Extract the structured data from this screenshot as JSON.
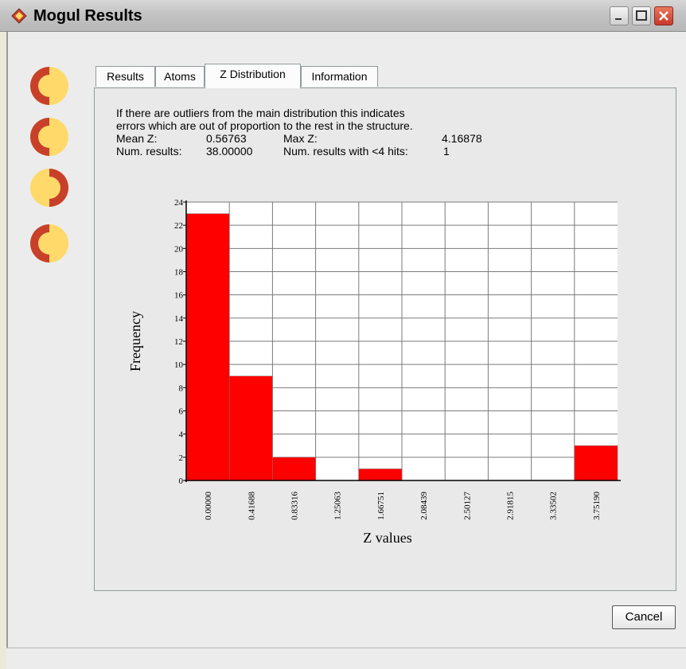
{
  "window": {
    "title": "Mogul Results"
  },
  "sidebar": {
    "icons": [
      "crescent-left-icon",
      "crescent-left-icon",
      "crescent-right-icon",
      "crescent-left-icon"
    ]
  },
  "tabs": [
    {
      "label": "Results",
      "active": false
    },
    {
      "label": "Atoms",
      "active": false
    },
    {
      "label": "Z Distribution",
      "active": true
    },
    {
      "label": "Information",
      "active": false
    }
  ],
  "summary": {
    "line1": "If there are outliers from the main distribution this indicates",
    "line2": "errors which are out of proportion to the rest in the structure.",
    "mean_z_label": "Mean Z:",
    "mean_z_value": "0.56763",
    "max_z_label": "Max Z:",
    "max_z_value": "4.16878",
    "num_results_label": "Num. results:",
    "num_results_value": "38.00000",
    "num_lt4_label": "Num. results with <4 hits:",
    "num_lt4_value": "1"
  },
  "chart_data": {
    "type": "bar",
    "categories": [
      "0.00000",
      "0.41688",
      "0.83316",
      "1.25063",
      "1.66751",
      "2.08439",
      "2.50127",
      "2.91815",
      "3.33502",
      "3.75190"
    ],
    "values": [
      23,
      9,
      2,
      0,
      1,
      0,
      0,
      0,
      0,
      3
    ],
    "xlabel": "Z values",
    "ylabel": "Frequency",
    "ylim": [
      0,
      24
    ],
    "yticks": [
      0,
      2,
      4,
      6,
      8,
      10,
      12,
      14,
      16,
      18,
      20,
      22,
      24
    ],
    "grid": true,
    "bar_color": "#ff0000"
  },
  "buttons": {
    "cancel": "Cancel"
  },
  "colors": {
    "crescent_red": "#c8402a",
    "crescent_yellow": "#ffd96a",
    "bar": "#ff0000"
  }
}
